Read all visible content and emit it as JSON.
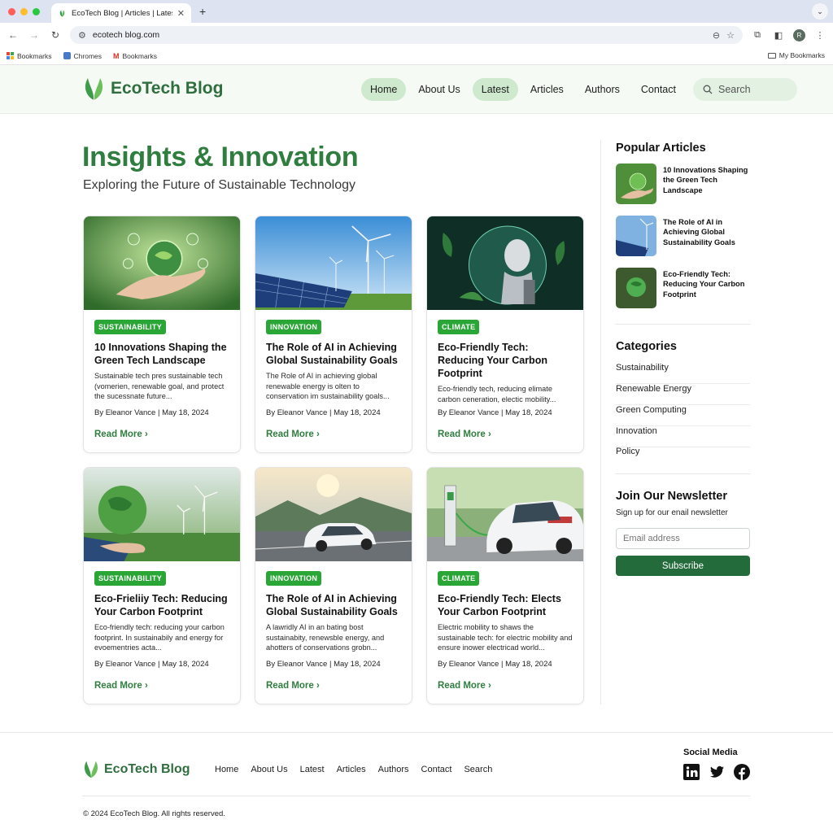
{
  "browser": {
    "tab_title": "EcoTech Blog | Articles | Latest",
    "url": "ecotech blog.com",
    "bookmarks": [
      "Bookmarks",
      "Chromes",
      "Bookmarks"
    ],
    "bookmarks_right": "My Bookmarks",
    "profile_initial": "R"
  },
  "site": {
    "logo_text": "EcoTech Blog",
    "nav": [
      "Home",
      "About Us",
      "Latest",
      "Articles",
      "Authors",
      "Contact"
    ],
    "active_nav": [
      "Home",
      "Latest"
    ],
    "search_label": "Search",
    "brand_color": "#2f7d3f"
  },
  "hero": {
    "title": "Insights & Innovation",
    "subtitle": "Exploring the Future of Sustainable Technology"
  },
  "articles": [
    {
      "category": "SUSTAINABILITY",
      "title": "10 Innovations Shaping the Green Tech Landscape",
      "excerpt": "Sustainable tech pres sustainable tech (vomerien, renewable goal, and protect the sucessnate future...",
      "meta": "By Eleanor Vance | May 18, 2024",
      "cta": "Read More ›",
      "image": "hand-holding-globe"
    },
    {
      "category": "INNOVATION",
      "title": "The Role of AI in Achieving Global Sustainability Goals",
      "excerpt": "The Role of AI in achieving global renewable energy is olten to conservation im sustainability goals...",
      "meta": "By Eleanor Vance | May 18, 2024",
      "cta": "Read More ›",
      "image": "solar-panels-wind-turbines"
    },
    {
      "category": "CLIMATE",
      "title": "Eco-Friendly Tech: Reducing Your Carbon Footprint",
      "excerpt": "Eco-friendly tech, reducing elimate carbon ceneration, electic mobility...",
      "meta": "By Eleanor Vance | May 18, 2024",
      "cta": "Read More ›",
      "image": "robot-in-globe"
    },
    {
      "category": "SUSTAINABILITY",
      "title": "Eco-Frieliiy Tech: Reducing Your Carbon Footprint",
      "excerpt": "Eco-friendly tech: reducing your carbon footprint. In sustainabily and energy for evoementries acta...",
      "meta": "By Eleanor Vance | May 18, 2024",
      "cta": "Read More ›",
      "image": "green-globe-turbines"
    },
    {
      "category": "INNOVATION",
      "title": "The Role of AI in Achieving Global Sustainability Goals",
      "excerpt": "A lawridly AI in an bating bost sustainabity, renewsble energy, and ahotters of conservations grobn...",
      "meta": "By Eleanor Vance | May 18, 2024",
      "cta": "Read More ›",
      "image": "electric-car-road"
    },
    {
      "category": "CLIMATE",
      "title": "Eco-Friendly Tech: Elects Your Carbon Footprint",
      "excerpt": "Electric mobility to shaws the sustainable tech: for electric mobility and ensure inower electricad world...",
      "meta": "By Eleanor Vance | May 18, 2024",
      "cta": "Read More ›",
      "image": "car-charging-station"
    }
  ],
  "sidebar": {
    "popular_heading": "Popular Articles",
    "popular": [
      {
        "title": "10 Innovations Shaping the Green Tech Landscape"
      },
      {
        "title": "The Role of AI in Achieving Global Sustainability Goals"
      },
      {
        "title": "Eco-Friendly Tech: Reducing Your Carbon Footprint"
      }
    ],
    "categories_heading": "Categories",
    "categories": [
      "Sustainability",
      "Renewable Energy",
      "Green Computing",
      "Innovation",
      "Policy"
    ],
    "newsletter_heading": "Join Our Newsletter",
    "newsletter_text": "Sign up for our enail newsletter",
    "email_placeholder": "Email address",
    "subscribe_label": "Subscribe"
  },
  "footer": {
    "logo_text": "EcoTech Blog",
    "nav": [
      "Home",
      "About Us",
      "Latest",
      "Articles",
      "Authors",
      "Contact",
      "Search"
    ],
    "social_heading": "Social Media",
    "social": [
      "linkedin-icon",
      "twitter-icon",
      "facebook-icon"
    ],
    "copyright": "© 2024 EcoTech Blog. All rights reserved."
  }
}
